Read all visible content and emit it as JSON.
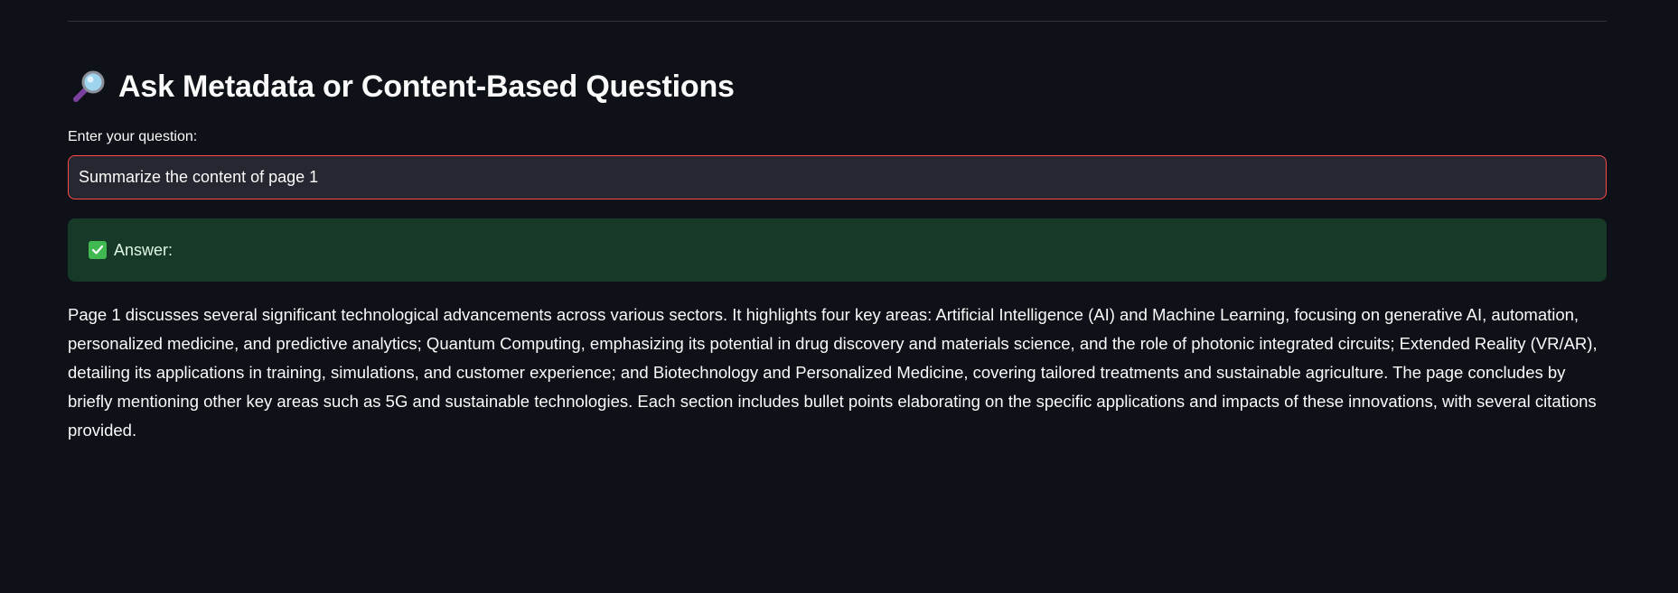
{
  "section": {
    "icon": "magnifying-glass-icon",
    "title": "Ask Metadata or Content-Based Questions"
  },
  "question": {
    "label": "Enter your question:",
    "value": "Summarize the content of page 1"
  },
  "answer": {
    "icon": "check-mark-icon",
    "label": "Answer:",
    "text": "Page 1 discusses several significant technological advancements across various sectors. It highlights four key areas: Artificial Intelligence (AI) and Machine Learning, focusing on generative AI, automation, personalized medicine, and predictive analytics; Quantum Computing, emphasizing its potential in drug discovery and materials science, and the role of photonic integrated circuits; Extended Reality (VR/AR), detailing its applications in training, simulations, and customer experience; and Biotechnology and Personalized Medicine, covering tailored treatments and sustainable agriculture. The page concludes by briefly mentioning other key areas such as 5G and sustainable technologies. Each section includes bullet points elaborating on the specific applications and impacts of these innovations, with several citations provided."
  },
  "colors": {
    "background": "#0e1117",
    "input_border": "#ff4b4b",
    "answer_background": "#173928"
  }
}
